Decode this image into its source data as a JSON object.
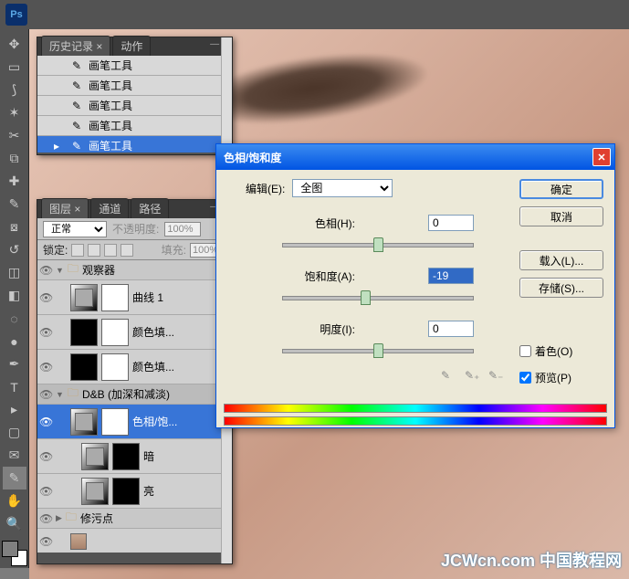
{
  "app": {
    "logo": "Ps"
  },
  "history": {
    "tab_active": "历史记录",
    "tab_inactive": "动作",
    "items": [
      {
        "label": "画笔工具",
        "selected": false
      },
      {
        "label": "画笔工具",
        "selected": false
      },
      {
        "label": "画笔工具",
        "selected": false
      },
      {
        "label": "画笔工具",
        "selected": false
      },
      {
        "label": "画笔工具",
        "selected": true
      }
    ]
  },
  "layers_panel": {
    "tabs": [
      "图层",
      "通道",
      "路径"
    ],
    "blend_mode": "正常",
    "opacity_label": "不透明度:",
    "opacity_value": "100%",
    "lock_label": "锁定:",
    "fill_label": "填充:",
    "fill_value": "100%",
    "groups": [
      {
        "name": "观察器",
        "expanded": true,
        "layers": [
          {
            "name": "曲线 1",
            "type": "adj",
            "mask": "white"
          },
          {
            "name": "颜色填...",
            "type": "adj",
            "mask": "black-white"
          },
          {
            "name": "颜色填...",
            "type": "adj",
            "mask": "black-white"
          }
        ]
      },
      {
        "name": "D&B (加深和减淡)",
        "expanded": true,
        "selected": true,
        "layers": [
          {
            "name": "色相/饱...",
            "type": "adj",
            "mask": "white",
            "selected": true
          },
          {
            "name": "暗",
            "type": "adj",
            "mask": "black"
          },
          {
            "name": "亮",
            "type": "adj",
            "mask": "black"
          }
        ]
      },
      {
        "name": "修污点",
        "expanded": false,
        "layers": []
      }
    ],
    "image_layer": true
  },
  "hsl": {
    "title": "色相/饱和度",
    "edit_label": "编辑(E):",
    "edit_value": "全图",
    "hue_label": "色相(H):",
    "hue_value": "0",
    "sat_label": "饱和度(A):",
    "sat_value": "-19",
    "light_label": "明度(I):",
    "light_value": "0",
    "ok": "确定",
    "cancel": "取消",
    "load": "载入(L)...",
    "save": "存储(S)...",
    "colorize": "着色(O)",
    "preview": "预览(P)",
    "colorize_checked": false,
    "preview_checked": true
  },
  "watermark": "JCWcn.com 中国教程网"
}
